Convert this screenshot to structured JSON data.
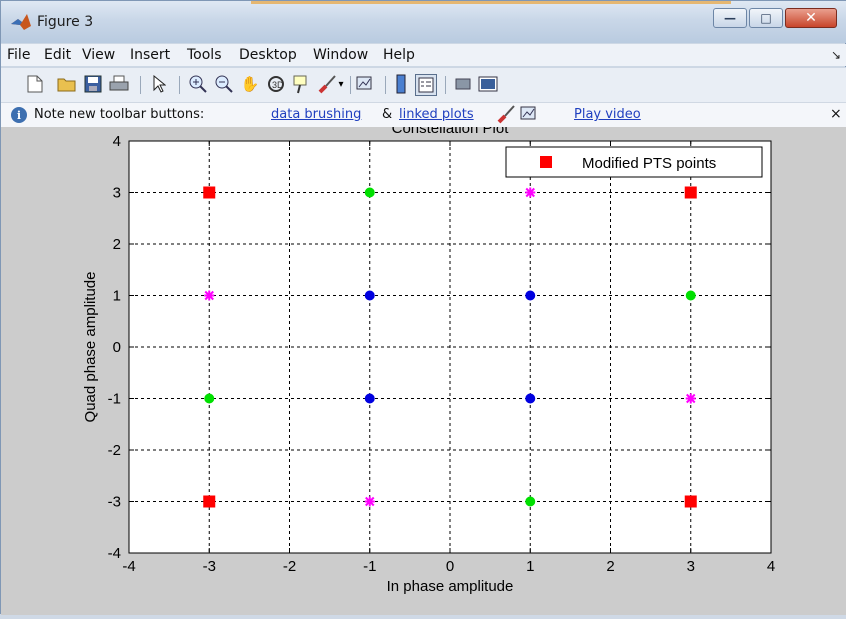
{
  "window": {
    "title": "Figure 3",
    "controls": {
      "minimize": "—",
      "maximize": "□",
      "close": "✕"
    }
  },
  "menubar": {
    "items": [
      "File",
      "Edit",
      "View",
      "Insert",
      "Tools",
      "Desktop",
      "Window",
      "Help"
    ],
    "overflow_icon": "chevron-icon"
  },
  "toolbar": {
    "icons": [
      "new-figure-icon",
      "open-icon",
      "save-icon",
      "print-icon",
      "pointer-icon",
      "zoom-in-icon",
      "zoom-out-icon",
      "pan-icon",
      "rotate-icon",
      "data-cursor-icon",
      "brush-icon",
      "brush-dropdown-icon",
      "link-plot-icon",
      "colorbar-icon",
      "legend-icon",
      "hide-plot-tools-icon",
      "show-plot-tools-icon"
    ]
  },
  "notebar": {
    "text": "Note new toolbar buttons:",
    "link_brushing": "data brushing",
    "ampersand": "&",
    "link_linked": "linked plots",
    "link_video": "Play video",
    "close": "×"
  },
  "chart_data": {
    "type": "scatter",
    "title": "Constellation Plot",
    "xlabel": "In phase amplitude",
    "ylabel": "Quad phase amplitude",
    "xlim": [
      -4,
      4
    ],
    "ylim": [
      -4,
      4
    ],
    "xticks": [
      "-4",
      "-3",
      "-2",
      "-1",
      "0",
      "1",
      "2",
      "3",
      "4"
    ],
    "yticks": [
      "4",
      "3",
      "2",
      "1",
      "0",
      "-1",
      "-2",
      "-3",
      "-4"
    ],
    "grid": true,
    "legend": {
      "placement": "top-right",
      "entries": [
        "Modified PTS points"
      ]
    },
    "series": [
      {
        "name": "Modified PTS points",
        "marker": "square",
        "color": "#ff0000",
        "points": [
          [
            -3,
            3
          ],
          [
            3,
            3
          ],
          [
            -3,
            -3
          ],
          [
            3,
            -3
          ]
        ]
      },
      {
        "marker": "circle",
        "color": "#00e000",
        "points": [
          [
            -1,
            3
          ],
          [
            3,
            1
          ],
          [
            -3,
            -1
          ],
          [
            1,
            -3
          ]
        ]
      },
      {
        "marker": "star",
        "color": "#ff00ff",
        "points": [
          [
            1,
            3
          ],
          [
            -3,
            1
          ],
          [
            3,
            -1
          ],
          [
            -1,
            -3
          ]
        ]
      },
      {
        "marker": "circle",
        "color": "#0000e0",
        "points": [
          [
            -1,
            1
          ],
          [
            1,
            1
          ],
          [
            -1,
            -1
          ],
          [
            1,
            -1
          ]
        ]
      }
    ]
  }
}
